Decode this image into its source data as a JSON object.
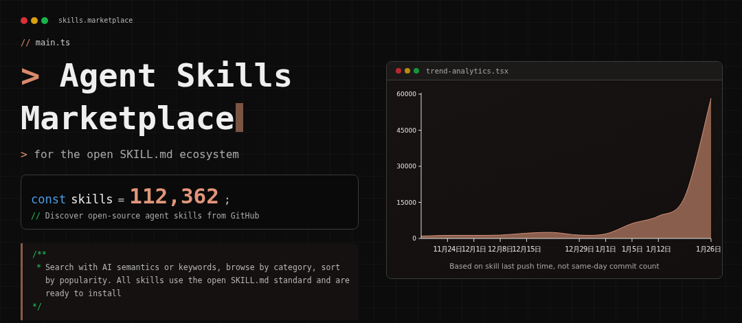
{
  "header": {
    "title": "skills.marketplace"
  },
  "file_comment": {
    "prefix": "//",
    "text": "main.ts"
  },
  "hero": {
    "prompt": ">",
    "title": "Agent Skills Marketplace"
  },
  "tagline": {
    "prompt": ">",
    "text": "for the open SKILL.md ecosystem"
  },
  "stat_card": {
    "keyword": "const",
    "name": "skills",
    "operator": "=",
    "value": "112,362",
    "terminator": ";",
    "comment_prefix": "//",
    "comment": "Discover open-source agent skills from GitHub"
  },
  "doc_comment": {
    "open": "/**",
    "bullet": "*",
    "text": "Search with AI semantics or keywords, browse by category, sort by popularity. All skills use the open SKILL.md standard and are ready to install",
    "close": "*/"
  },
  "chart_window": {
    "title": "trend-analytics.tsx",
    "chart_data": {
      "type": "area",
      "categories": [
        null,
        "11月24日",
        "12月1日",
        "12月8日",
        "12月15日",
        null,
        "12月29日",
        "1月1日",
        "1月5日",
        "1月12日",
        null,
        "1月26日"
      ],
      "series": [
        {
          "color": "#8a5e4d",
          "values": [
            1000,
            1300,
            1300,
            1400,
            2200,
            2500,
            1400,
            1900,
            6200,
            9300,
            17300,
            58300
          ]
        }
      ],
      "yticks": [
        0,
        15000,
        30000,
        45000,
        60000
      ],
      "ylim": [
        0,
        60000
      ]
    },
    "caption": "Based on skill last push time, not same-day commit count"
  }
}
